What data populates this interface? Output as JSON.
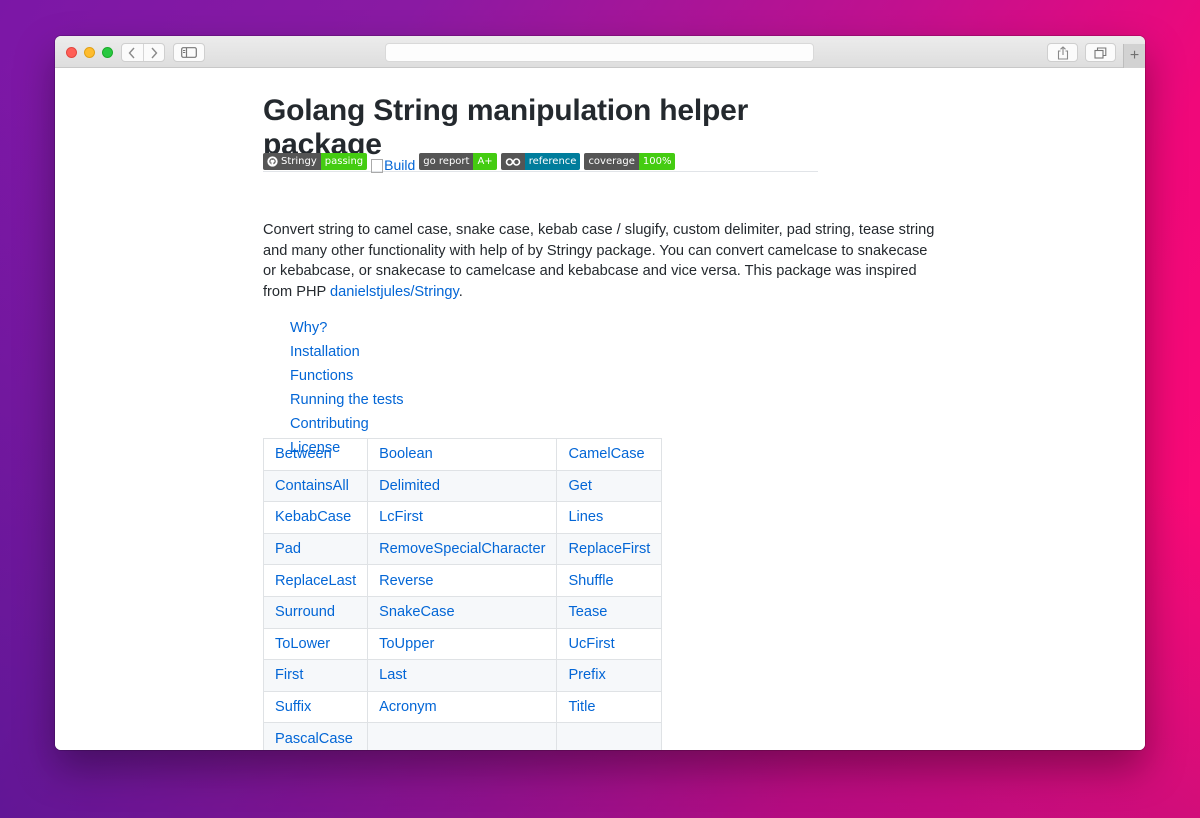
{
  "browser": {
    "nav_back": "‹",
    "nav_forward": "›",
    "new_tab": "+",
    "address": ""
  },
  "page": {
    "title": "Golang String manipulation helper package",
    "badges": [
      {
        "label": "Stringy",
        "value": "passing",
        "value_color": "#4c1"
      },
      {
        "label": "go report",
        "value": "A+",
        "value_color": "#4c1"
      },
      {
        "label": "reference",
        "value": "",
        "value_color": "#007d9c"
      },
      {
        "label": "coverage",
        "value": "100%",
        "value_color": "#4c1"
      }
    ],
    "broken_image_alt": "Build",
    "description": "Convert string to camel case, snake case, kebab case / slugify, custom delimiter, pad string, tease string and many other functionality with help of by Stringy package. You can convert camelcase to snakecase or kebabcase, or snakecase to camelcase and kebabcase and vice versa. This package was inspired from PHP ",
    "description_link": "danielstjules/Stringy",
    "description_end": ".",
    "toc": [
      "Why?",
      "Installation",
      "Functions",
      "Running the tests",
      "Contributing",
      "License"
    ],
    "functions_table": [
      [
        "Between",
        "Boolean",
        "CamelCase"
      ],
      [
        "ContainsAll",
        "Delimited",
        "Get"
      ],
      [
        "KebabCase",
        "LcFirst",
        "Lines"
      ],
      [
        "Pad",
        "RemoveSpecialCharacter",
        "ReplaceFirst"
      ],
      [
        "ReplaceLast",
        "Reverse",
        "Shuffle"
      ],
      [
        "Surround",
        "SnakeCase",
        "Tease"
      ],
      [
        "ToLower",
        "ToUpper",
        "UcFirst"
      ],
      [
        "First",
        "Last",
        "Prefix"
      ],
      [
        "Suffix",
        "Acronym",
        "Title"
      ],
      [
        "PascalCase",
        "",
        ""
      ]
    ]
  },
  "colors": {
    "link": "#0366d6",
    "text": "#24292e",
    "badge_label_bg": "#555555",
    "badge_green": "#44cc11",
    "badge_blue": "#007d9c"
  }
}
